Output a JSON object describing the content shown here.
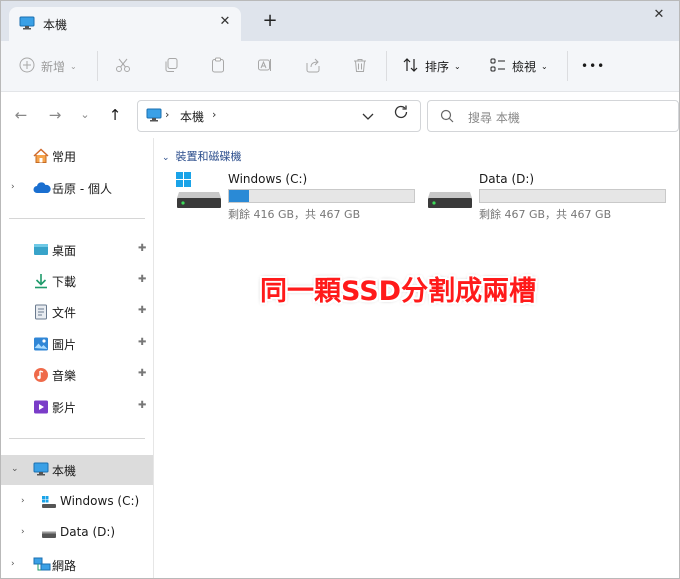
{
  "tab": {
    "title": "本機",
    "close": "✕",
    "icon": "this-pc-icon"
  },
  "window": {
    "close": "✕",
    "new_tab": "+"
  },
  "toolbar": {
    "new_label": "新增",
    "sort_label": "排序",
    "view_label": "檢視",
    "more": "•••",
    "icons": [
      "plus-icon",
      "cut-icon",
      "copy-icon",
      "paste-icon",
      "rename-icon",
      "share-icon",
      "delete-icon",
      "sort-icon",
      "view-icon",
      "more-icon"
    ]
  },
  "address": {
    "separator": "›",
    "crumb": "本機"
  },
  "search": {
    "placeholder": "搜尋 本機"
  },
  "nav": {
    "home": "常用",
    "onedrive": "岳原 - 個人",
    "quick": [
      "桌面",
      "下載",
      "文件",
      "圖片",
      "音樂",
      "影片"
    ],
    "this_pc": "本機",
    "drives": [
      "Windows (C:)",
      "Data (D:)"
    ],
    "network": "網路",
    "expand_right": "›",
    "expand_down": "⌄",
    "pin": "📌"
  },
  "content": {
    "group_label": "裝置和磁碟機",
    "drives": [
      {
        "name": "Windows (C:)",
        "free": "剩餘 416 GB，共 467 GB",
        "used_fraction": 0.11
      },
      {
        "name": "Data (D:)",
        "free": "剩餘 467 GB，共 467 GB",
        "used_fraction": 0.0
      }
    ]
  },
  "annotation": "同一顆SSD分割成兩槽",
  "colors": {
    "accent": "#2a8ad6",
    "annotation": "#ff1a1a",
    "group_label": "#2b4d8c"
  }
}
